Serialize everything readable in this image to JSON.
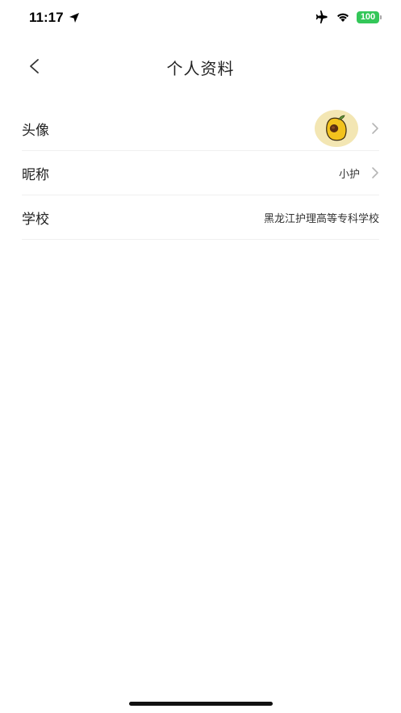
{
  "status_bar": {
    "time": "11:17",
    "battery": "100",
    "icons": [
      "location-arrow-icon",
      "airplane-icon",
      "wifi-icon",
      "battery-icon"
    ]
  },
  "nav": {
    "title": "个人资料",
    "back_icon": "chevron-left-icon"
  },
  "profile": {
    "avatar_label": "头像",
    "nickname_label": "昵称",
    "nickname_value": "小护",
    "school_label": "学校",
    "school_value": "黑龙江护理高等专科学校"
  },
  "colors": {
    "battery_green": "#34c759",
    "avatar_bg": "#f3e6b3",
    "divider": "#f0f0f0",
    "chevron": "#b5b5b5"
  }
}
